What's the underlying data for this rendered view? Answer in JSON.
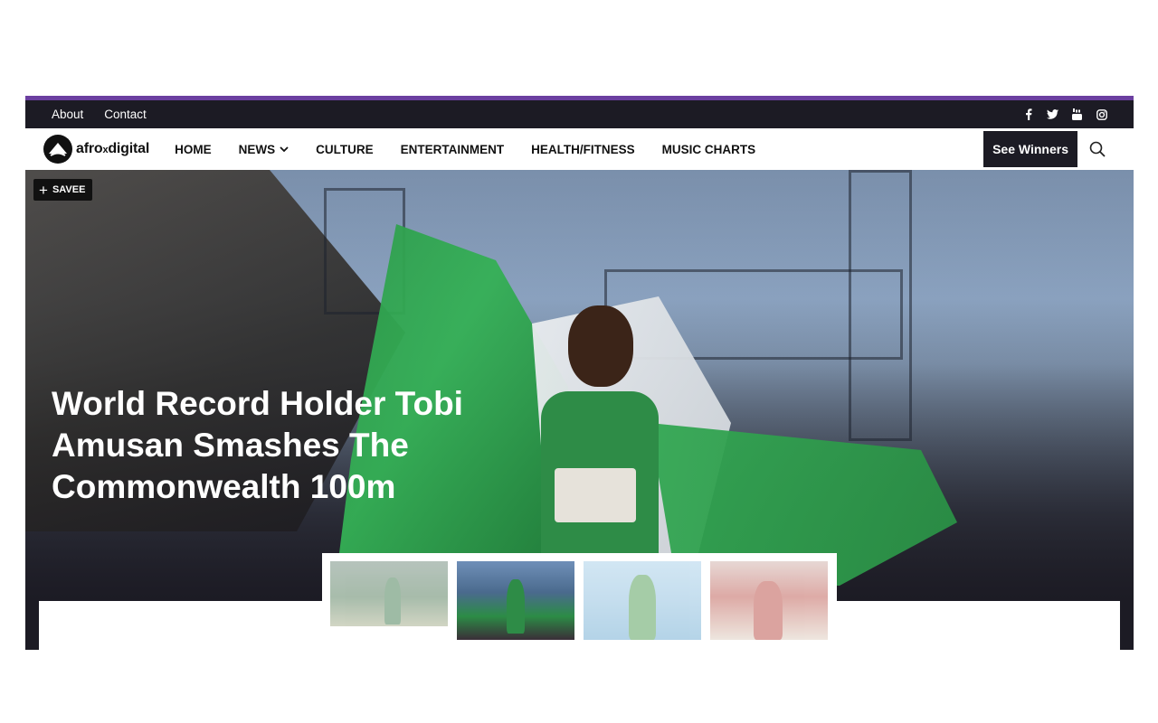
{
  "topbar": {
    "links": [
      "About",
      "Contact"
    ],
    "social_icons": [
      "facebook-icon",
      "twitter-icon",
      "youtube-icon",
      "instagram-icon"
    ]
  },
  "brand": {
    "name_left": "afro",
    "name_x": "x",
    "name_right": "digital"
  },
  "nav": {
    "items": [
      "HOME",
      "NEWS",
      "CULTURE",
      "ENTERTAINMENT",
      "HEALTH/FITNESS",
      "MUSIC CHARTS"
    ],
    "cta_label": "See Winners"
  },
  "hero": {
    "save_label": "SAVEE",
    "headline": "World Record Holder Tobi Amusan Smashes The Commonwealth 100m"
  },
  "carousel": {
    "count": 4,
    "active_index": 1
  },
  "colors": {
    "accent": "#6b3fa0",
    "dark": "#1c1b24",
    "white": "#ffffff"
  }
}
